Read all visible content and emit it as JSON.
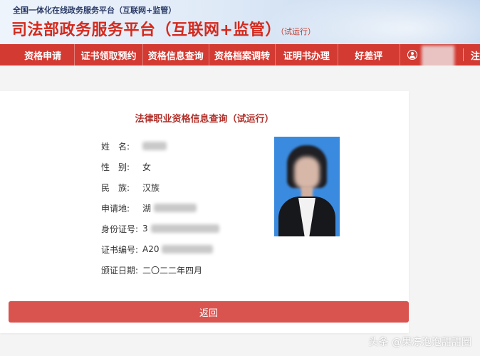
{
  "header": {
    "subtitle": "全国一体化在线政务服务平台（互联网+监管）",
    "title": "司法部政务服务平台（互联网+监管）",
    "trial_tag": "（试运行）"
  },
  "nav": {
    "items": [
      {
        "label": "资格申请"
      },
      {
        "label": "证书领取预约"
      },
      {
        "label": "资格信息查询"
      },
      {
        "label": "资格档案调转"
      },
      {
        "label": "证明书办理"
      },
      {
        "label": "好差评"
      }
    ],
    "cut_label": "注"
  },
  "card": {
    "title": "法律职业资格信息查询（试运行）",
    "fields": [
      {
        "label": "姓　名:",
        "value": ""
      },
      {
        "label": "性　别:",
        "value": "女"
      },
      {
        "label": "民　族:",
        "value": "汉族"
      },
      {
        "label": "申请地:",
        "value": "湖"
      },
      {
        "label": "身份证号:",
        "value": "3"
      },
      {
        "label": "证书编号:",
        "value": "A20"
      },
      {
        "label": "颁证日期:",
        "value": "二〇二二年四月"
      }
    ],
    "back_button": "返回"
  },
  "watermark": "头条 @果冻泡泡甜甜圈",
  "colors": {
    "brand_red": "#d33a32",
    "title_red": "#d42a1e",
    "button_red": "#d9534f",
    "photo_bg": "#3a8be0"
  }
}
